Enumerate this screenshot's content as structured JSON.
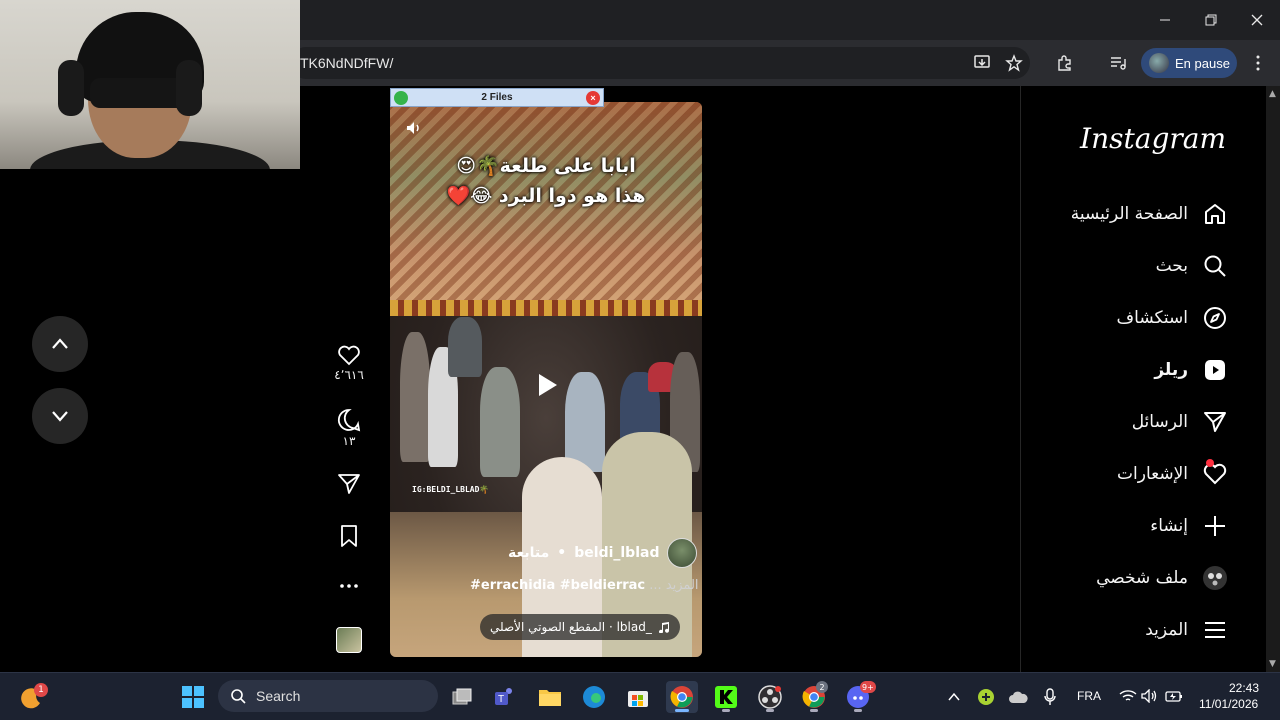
{
  "browser": {
    "url_fragment": "TK6NdNDfFW/",
    "profile_label": "En pause"
  },
  "popup": {
    "title": "2 Files",
    "close_symbol": "×"
  },
  "instagram": {
    "logo": "Instagram",
    "nav": [
      {
        "label": "الصفحة الرئيسية",
        "icon": "home-icon"
      },
      {
        "label": "بحث",
        "icon": "search-icon"
      },
      {
        "label": "استكشاف",
        "icon": "compass-icon"
      },
      {
        "label": "ريلز",
        "icon": "reels-icon"
      },
      {
        "label": "الرسائل",
        "icon": "send-icon"
      },
      {
        "label": "الإشعارات",
        "icon": "heart-icon"
      },
      {
        "label": "إنشاء",
        "icon": "plus-icon"
      },
      {
        "label": "ملف شخصي",
        "icon": "profile-avatar-icon"
      },
      {
        "label": "المزيد",
        "icon": "menu-icon"
      }
    ]
  },
  "reel": {
    "caption_line1": "ابابا على طلعة🌴😍",
    "caption_line2": "هذا هو دوا البرد 😂❤️",
    "watermark": "IG:BELDI_LBLAD🌴",
    "username": "beldi_lblad",
    "separator": "•",
    "follow_label": "متابعة",
    "hashtags": "#errachidia #beldierrac",
    "more_label": "... المزيد",
    "audio_label": "المقطع الصوتي الأصلي · lblad_"
  },
  "actions": {
    "likes": "٤٬٦١٦",
    "comments": "١٣"
  },
  "taskbar": {
    "search_placeholder": "Search",
    "weather_badge": "1",
    "chrome_badge": "2",
    "discord_badge": "9+",
    "language": "FRA",
    "time": "22:43",
    "date": "11/01/2026"
  }
}
